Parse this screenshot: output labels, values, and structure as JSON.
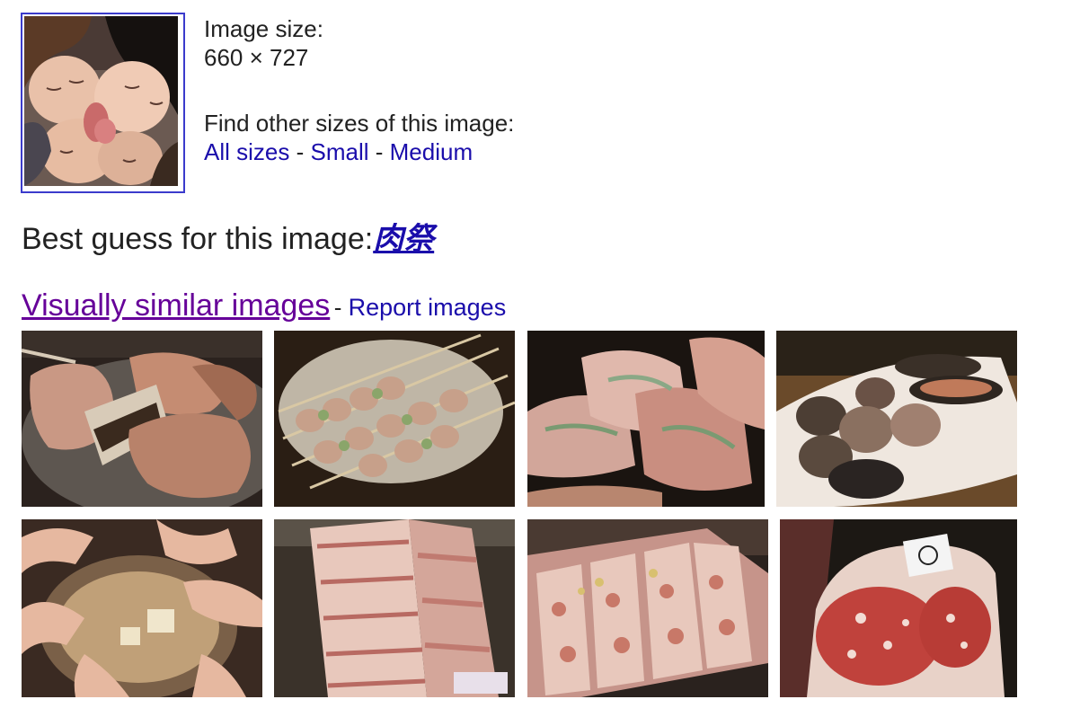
{
  "image_info": {
    "size_label": "Image size:",
    "size_value": "660 × 727",
    "other_sizes_label": "Find other sizes of this image:",
    "size_links": [
      "All sizes",
      "Small",
      "Medium"
    ],
    "separator": "-"
  },
  "best_guess": {
    "label": "Best guess for this image:",
    "value": "肉祭"
  },
  "similar": {
    "title": "Visually similar images",
    "separator": "-",
    "report_label": "Report images",
    "thumbnails": [
      {
        "name": "grilled-pork-thumbnail",
        "subject": "grilled-meat-icon"
      },
      {
        "name": "yakitori-skewers-thumbnail",
        "subject": "skewer-icon"
      },
      {
        "name": "raw-meat-slices-thumbnail",
        "subject": "meat-icon"
      },
      {
        "name": "clams-plate-thumbnail",
        "subject": "shellfish-icon"
      },
      {
        "name": "hotpot-hands-thumbnail",
        "subject": "hotpot-icon"
      },
      {
        "name": "pork-belly-slab-thumbnail",
        "subject": "meat-icon"
      },
      {
        "name": "wagyu-platter-thumbnail",
        "subject": "meat-icon"
      },
      {
        "name": "beef-rib-slab-thumbnail",
        "subject": "meat-icon"
      }
    ]
  }
}
